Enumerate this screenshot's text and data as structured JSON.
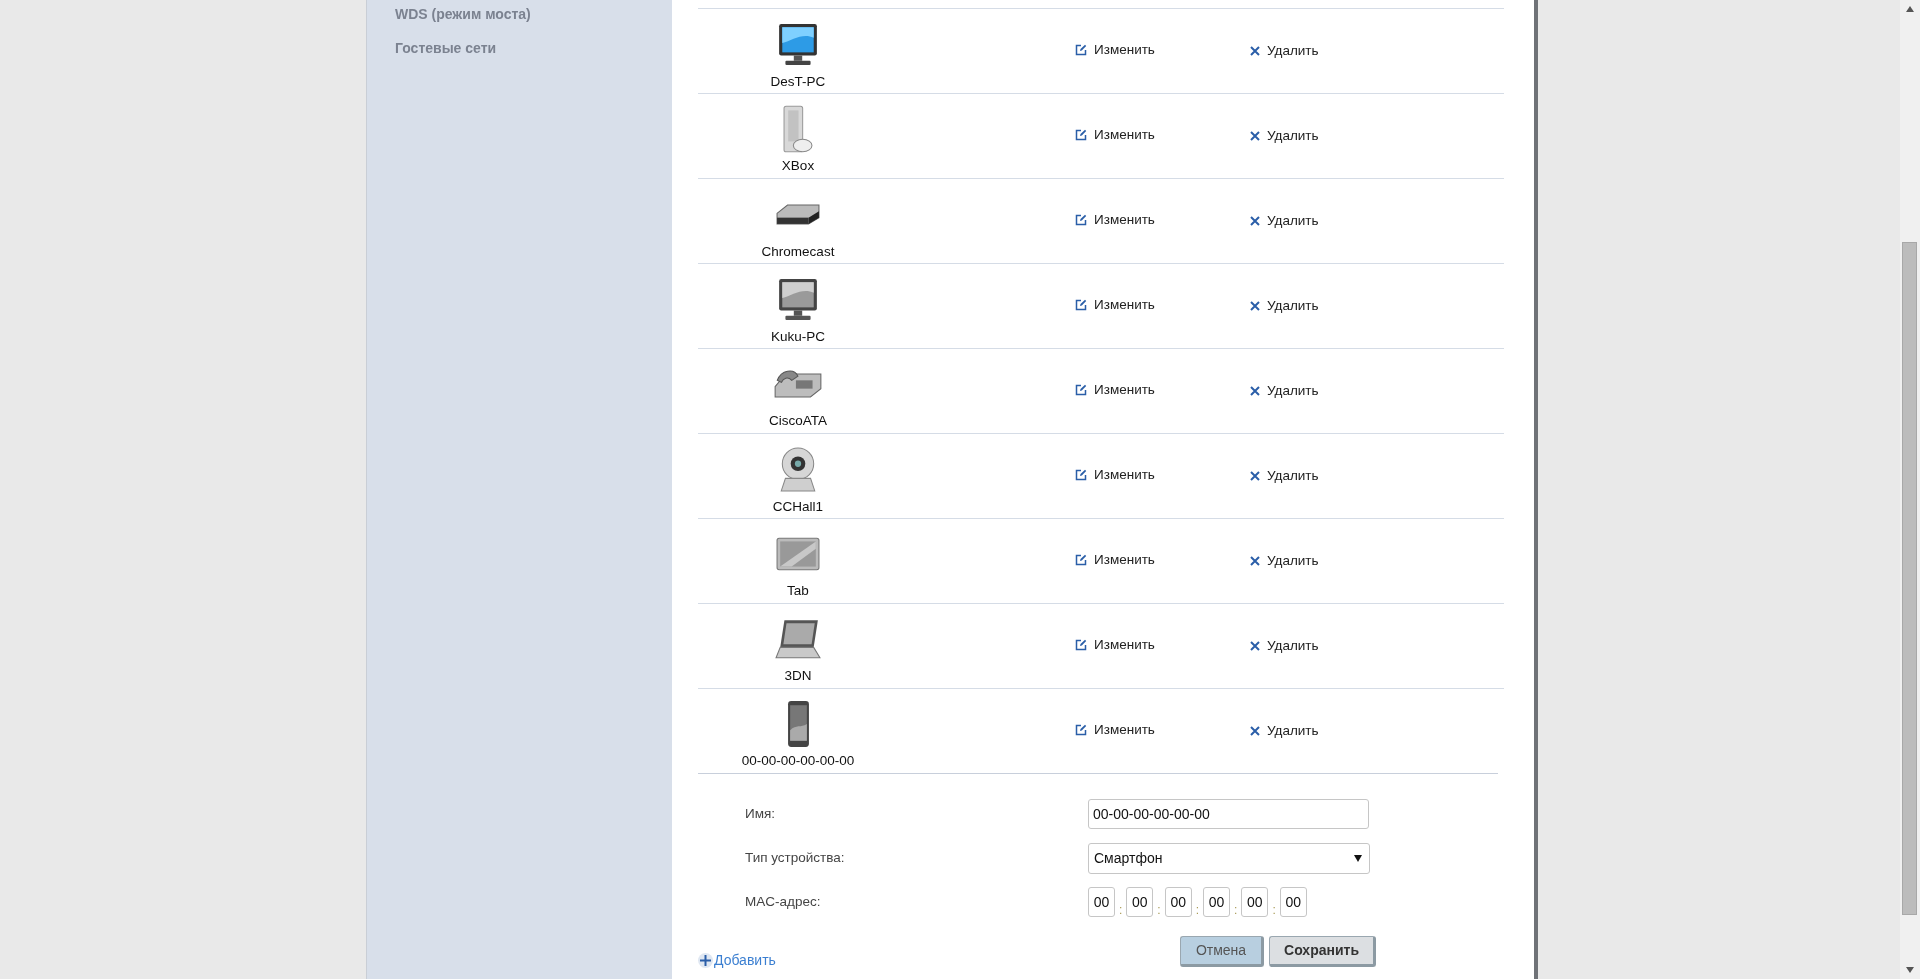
{
  "sidebar": {
    "items": [
      {
        "label": "WDS (режим моста)"
      },
      {
        "label": "Гостевые сети"
      }
    ]
  },
  "devices": [
    {
      "name": "DesT-PC",
      "kind": "monitor",
      "edit": "Изменить",
      "delete": "Удалить"
    },
    {
      "name": "XBox",
      "kind": "console",
      "edit": "Изменить",
      "delete": "Удалить"
    },
    {
      "name": "Chromecast",
      "kind": "settop",
      "edit": "Изменить",
      "delete": "Удалить"
    },
    {
      "name": "Kuku-PC",
      "kind": "terminal",
      "edit": "Изменить",
      "delete": "Удалить"
    },
    {
      "name": "CiscoATA",
      "kind": "phone",
      "edit": "Изменить",
      "delete": "Удалить"
    },
    {
      "name": "CCHall1",
      "kind": "camera",
      "edit": "Изменить",
      "delete": "Удалить"
    },
    {
      "name": "Tab",
      "kind": "tablet",
      "edit": "Изменить",
      "delete": "Удалить"
    },
    {
      "name": "3DN",
      "kind": "laptop",
      "edit": "Изменить",
      "delete": "Удалить"
    },
    {
      "name": "00-00-00-00-00-00",
      "kind": "smartphone",
      "edit": "Изменить",
      "delete": "Удалить"
    }
  ],
  "form": {
    "fields": [
      {
        "kind": "text",
        "label": "Имя:",
        "value": "00-00-00-00-00-00"
      },
      {
        "kind": "select",
        "label": "Тип устройства:",
        "value": "Смартфон"
      },
      {
        "kind": "mac",
        "label": "MAC-адрес:",
        "separator": ":",
        "octets": [
          "00",
          "00",
          "00",
          "00",
          "00",
          "00"
        ]
      }
    ]
  },
  "add_link": "Добавить",
  "buttons": [
    {
      "label": "Отмена",
      "primary": false
    },
    {
      "label": "Сохранить",
      "primary": true
    }
  ]
}
